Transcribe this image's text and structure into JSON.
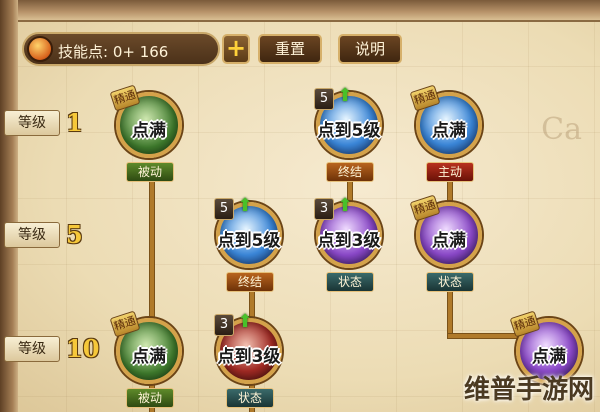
{
  "header": {
    "skill_points_label": "技能点: 0+ 166",
    "plus_label": "+",
    "reset_label": "重置",
    "help_label": "说明"
  },
  "levels": [
    {
      "tag": "等级",
      "num": "1"
    },
    {
      "tag": "等级",
      "num": "5"
    },
    {
      "tag": "等级",
      "num": "10"
    }
  ],
  "nodes": {
    "n1": {
      "caption": "点满",
      "badge": "精通",
      "type": "被动"
    },
    "n2": {
      "caption": "点到5级",
      "rank": "5",
      "type": "终结"
    },
    "n3": {
      "caption": "点满",
      "badge": "精通",
      "type": "主动"
    },
    "n4": {
      "caption": "点到5级",
      "rank": "5",
      "type": "终结"
    },
    "n5": {
      "caption": "点到3级",
      "rank": "3",
      "type": "状态"
    },
    "n6": {
      "caption": "点满",
      "badge": "精通",
      "type": "状态"
    },
    "n7": {
      "caption": "点满",
      "badge": "精通",
      "type": "被动"
    },
    "n8": {
      "caption": "点到3级",
      "rank": "3",
      "type": "状态"
    },
    "n9": {
      "caption": "点满",
      "badge": "精通",
      "type": ""
    }
  },
  "upgrade_arrow": "⬆",
  "watermark": "维普手游网",
  "bg_text": "Ca",
  "colors": {
    "gold": "#d4a24a",
    "line": "#b07a2a",
    "level_number": "#f6c83a",
    "upgrade_arrow": "#49c02a"
  }
}
